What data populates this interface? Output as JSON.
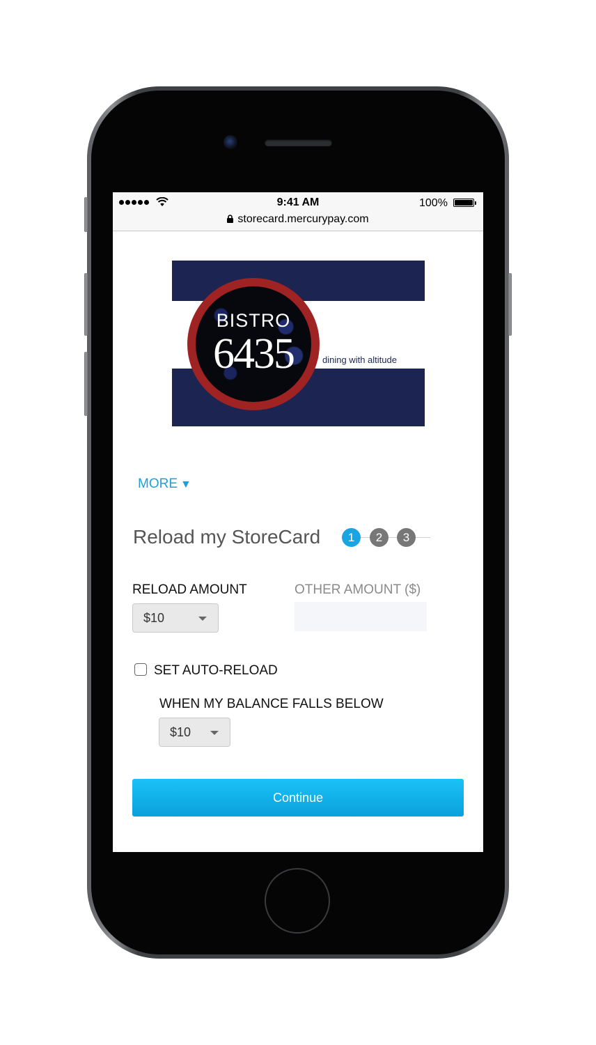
{
  "status_bar": {
    "time": "9:41 AM",
    "battery": "100%"
  },
  "browser": {
    "url": "storecard.mercurypay.com"
  },
  "logo": {
    "word": "BISTRO",
    "number": "6435",
    "tagline": "dining with altitude",
    "colors": {
      "navy": "#1c2551",
      "red": "#9e2322"
    }
  },
  "more": {
    "label": "MORE",
    "caret": "▼"
  },
  "reload": {
    "title": "Reload my StoreCard",
    "steps": [
      "1",
      "2",
      "3"
    ],
    "current_step": 1
  },
  "form": {
    "reload_amount_label": "RELOAD AMOUNT",
    "reload_amount_value": "$10",
    "other_amount_label": "OTHER AMOUNT ($)",
    "other_amount_value": "",
    "auto_reload_label": "SET AUTO-RELOAD",
    "auto_reload_checked": false,
    "balance_below_label": "WHEN MY BALANCE FALLS BELOW",
    "balance_below_value": "$10"
  },
  "actions": {
    "continue_label": "Continue"
  },
  "colors": {
    "accent": "#1aa5e2",
    "step_inactive": "#777777"
  }
}
